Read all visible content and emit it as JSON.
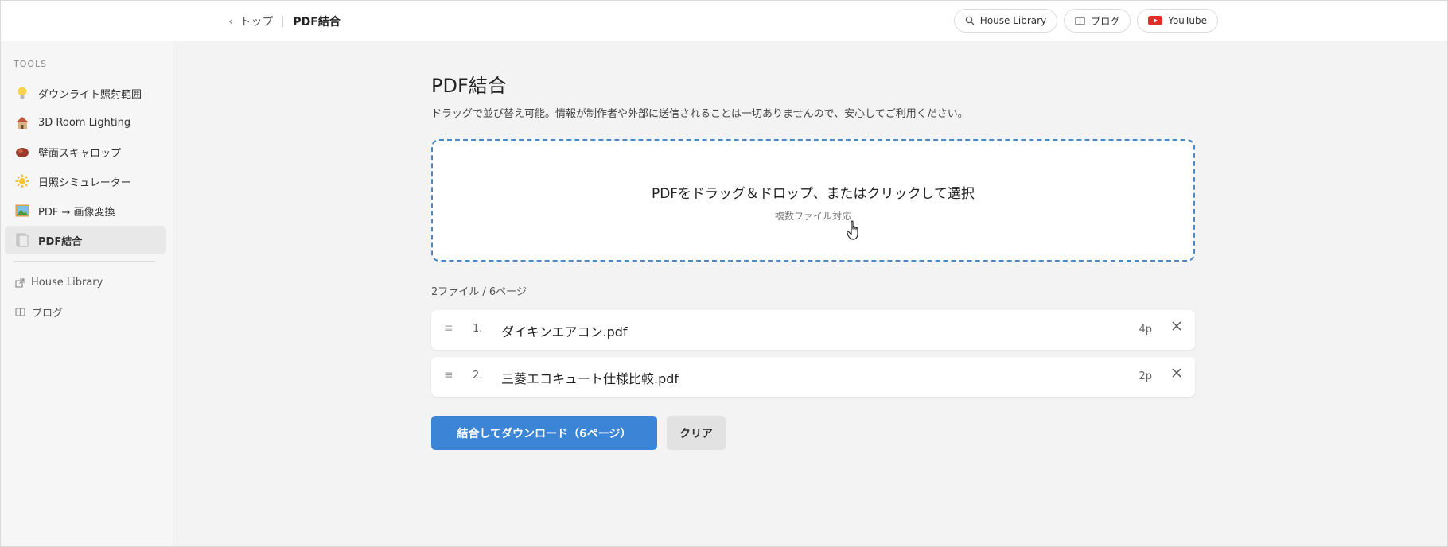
{
  "header": {
    "back_label": "トップ",
    "current": "PDF結合",
    "links": [
      {
        "label": "House Library",
        "icon": "search-icon"
      },
      {
        "label": "ブログ",
        "icon": "book-icon"
      },
      {
        "label": "YouTube",
        "icon": "youtube-icon",
        "color": "#e52d27"
      }
    ]
  },
  "sidebar": {
    "section_title": "TOOLS",
    "items": [
      {
        "label": "ダウンライト照射範囲",
        "icon": "lightbulb-icon"
      },
      {
        "label": "3D Room Lighting",
        "icon": "house-icon"
      },
      {
        "label": "壁面スキャロップ",
        "icon": "lamp-icon"
      },
      {
        "label": "日照シミュレーター",
        "icon": "sun-icon"
      },
      {
        "label": "PDF → 画像変換",
        "icon": "picture-icon"
      },
      {
        "label": "PDF結合",
        "icon": "document-icon",
        "active": true
      }
    ],
    "external": [
      {
        "label": "House Library",
        "icon": "external-link-icon"
      },
      {
        "label": "ブログ",
        "icon": "book-icon"
      }
    ]
  },
  "main": {
    "title": "PDF結合",
    "description": "ドラッグで並び替え可能。情報が制作者や外部に送信されることは一切ありませんので、安心してご利用ください。",
    "dropzone": {
      "main_text": "PDFをドラッグ＆ドロップ、またはクリックして選択",
      "sub_text": "複数ファイル対応"
    },
    "file_count": "2ファイル / 6ページ",
    "files": [
      {
        "index": "1.",
        "name": "ダイキンエアコン.pdf",
        "pages": "4p"
      },
      {
        "index": "2.",
        "name": "三菱エコキュート仕様比較.pdf",
        "pages": "2p"
      }
    ],
    "merge_button": "結合してダウンロード（6ページ）",
    "clear_button": "クリア"
  },
  "colors": {
    "accent": "#3b84d6",
    "dropzone_border": "#4a87c9"
  }
}
